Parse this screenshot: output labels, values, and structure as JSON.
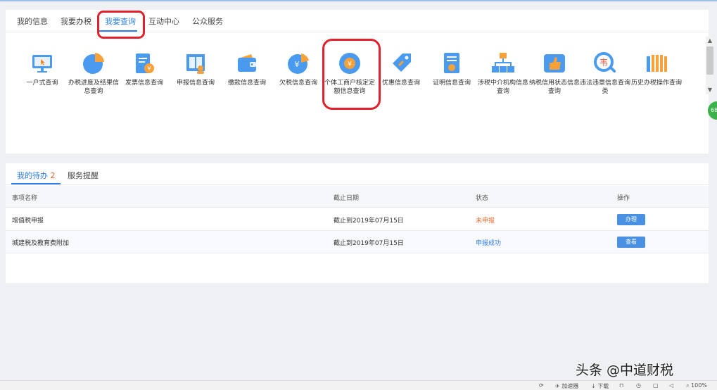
{
  "tabs": [
    {
      "label": "我的信息"
    },
    {
      "label": "我要办税"
    },
    {
      "label": "我要查询"
    },
    {
      "label": "互动中心"
    },
    {
      "label": "公众服务"
    }
  ],
  "active_tab": "我要查询",
  "query_items": [
    {
      "label": "一户式查询",
      "icon": "monitor-icon"
    },
    {
      "label": "办税进度及结果信息查询",
      "icon": "pie-chart-icon"
    },
    {
      "label": "发票信息查询",
      "icon": "invoice-icon"
    },
    {
      "label": "申报信息查询",
      "icon": "declaration-icon"
    },
    {
      "label": "缴款信息查询",
      "icon": "wallet-icon"
    },
    {
      "label": "欠税信息查询",
      "icon": "yen-pie-icon"
    },
    {
      "label": "个体工商户核定定额信息查询",
      "icon": "coin-circle-icon"
    },
    {
      "label": "优惠信息查询",
      "icon": "tag-icon"
    },
    {
      "label": "证明信息查询",
      "icon": "certificate-icon"
    },
    {
      "label": "涉税中介机构信息查询",
      "icon": "org-chart-icon"
    },
    {
      "label": "纳税信用状态信息查询",
      "icon": "thumbs-up-icon"
    },
    {
      "label": "违法违章信息查询类",
      "icon": "violation-search-icon"
    },
    {
      "label": "历史办税操作查询",
      "icon": "history-bars-icon"
    }
  ],
  "side_badge": "68",
  "todo": {
    "tab_label": "我的待办",
    "count": "2",
    "tab2_label": "服务提醒",
    "columns": [
      "事项名称",
      "截止日期",
      "状态",
      "操作"
    ],
    "rows": [
      {
        "name": "增值税申报",
        "deadline": "截止到2019年07月15日",
        "status": "未申报",
        "action": "办理"
      },
      {
        "name": "城建税及教育费附加",
        "deadline": "截止到2019年07月15日",
        "status": "申报成功",
        "action": "查看"
      }
    ]
  },
  "browser_bar": {
    "accelerator": "加速器",
    "download": "下载",
    "zoom": "100%"
  },
  "watermark": "头条 @中道财税",
  "colors": {
    "accent": "#2f80ed",
    "status_pending": "#f06a2c",
    "annotation": "#e0202b"
  }
}
